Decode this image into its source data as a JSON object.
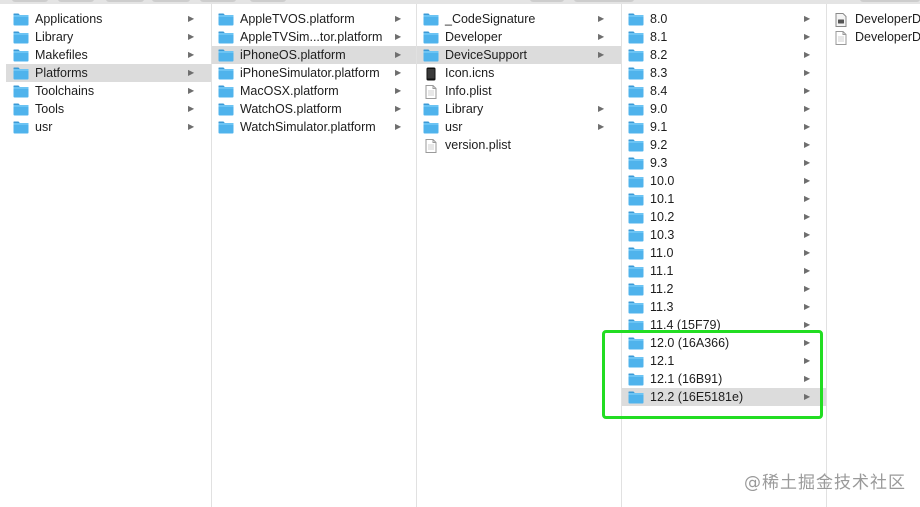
{
  "watermark": "@稀土掘金技术社区",
  "columns": [
    {
      "items": [
        {
          "label": "Applications",
          "icon": "folder-icon",
          "arrow": true,
          "selected": false
        },
        {
          "label": "Library",
          "icon": "folder-icon",
          "arrow": true,
          "selected": false
        },
        {
          "label": "Makefiles",
          "icon": "folder-icon",
          "arrow": true,
          "selected": false
        },
        {
          "label": "Platforms",
          "icon": "folder-icon",
          "arrow": true,
          "selected": true
        },
        {
          "label": "Toolchains",
          "icon": "folder-icon",
          "arrow": true,
          "selected": false
        },
        {
          "label": "Tools",
          "icon": "folder-icon",
          "arrow": true,
          "selected": false
        },
        {
          "label": "usr",
          "icon": "folder-icon",
          "arrow": true,
          "selected": false
        }
      ]
    },
    {
      "items": [
        {
          "label": "AppleTVOS.platform",
          "icon": "folder-icon",
          "arrow": true,
          "selected": false
        },
        {
          "label": "AppleTVSim...tor.platform",
          "icon": "folder-icon",
          "arrow": true,
          "selected": false
        },
        {
          "label": "iPhoneOS.platform",
          "icon": "folder-icon",
          "arrow": true,
          "selected": true
        },
        {
          "label": "iPhoneSimulator.platform",
          "icon": "folder-icon",
          "arrow": true,
          "selected": false
        },
        {
          "label": "MacOSX.platform",
          "icon": "folder-icon",
          "arrow": true,
          "selected": false
        },
        {
          "label": "WatchOS.platform",
          "icon": "folder-icon",
          "arrow": true,
          "selected": false
        },
        {
          "label": "WatchSimulator.platform",
          "icon": "folder-icon",
          "arrow": true,
          "selected": false
        }
      ]
    },
    {
      "items": [
        {
          "label": "_CodeSignature",
          "icon": "folder-icon",
          "arrow": true,
          "selected": false
        },
        {
          "label": "Developer",
          "icon": "folder-icon",
          "arrow": true,
          "selected": false
        },
        {
          "label": "DeviceSupport",
          "icon": "folder-icon",
          "arrow": true,
          "selected": true
        },
        {
          "label": "Icon.icns",
          "icon": "icns-file-icon",
          "arrow": false,
          "selected": false
        },
        {
          "label": "Info.plist",
          "icon": "plist-file-icon",
          "arrow": false,
          "selected": false
        },
        {
          "label": "Library",
          "icon": "folder-icon",
          "arrow": true,
          "selected": false
        },
        {
          "label": "usr",
          "icon": "folder-icon",
          "arrow": true,
          "selected": false
        },
        {
          "label": "version.plist",
          "icon": "plist-file-icon",
          "arrow": false,
          "selected": false
        }
      ]
    },
    {
      "items": [
        {
          "label": "8.0",
          "icon": "folder-icon",
          "arrow": true,
          "selected": false
        },
        {
          "label": "8.1",
          "icon": "folder-icon",
          "arrow": true,
          "selected": false
        },
        {
          "label": "8.2",
          "icon": "folder-icon",
          "arrow": true,
          "selected": false
        },
        {
          "label": "8.3",
          "icon": "folder-icon",
          "arrow": true,
          "selected": false
        },
        {
          "label": "8.4",
          "icon": "folder-icon",
          "arrow": true,
          "selected": false
        },
        {
          "label": "9.0",
          "icon": "folder-icon",
          "arrow": true,
          "selected": false
        },
        {
          "label": "9.1",
          "icon": "folder-icon",
          "arrow": true,
          "selected": false
        },
        {
          "label": "9.2",
          "icon": "folder-icon",
          "arrow": true,
          "selected": false
        },
        {
          "label": "9.3",
          "icon": "folder-icon",
          "arrow": true,
          "selected": false
        },
        {
          "label": "10.0",
          "icon": "folder-icon",
          "arrow": true,
          "selected": false
        },
        {
          "label": "10.1",
          "icon": "folder-icon",
          "arrow": true,
          "selected": false
        },
        {
          "label": "10.2",
          "icon": "folder-icon",
          "arrow": true,
          "selected": false
        },
        {
          "label": "10.3",
          "icon": "folder-icon",
          "arrow": true,
          "selected": false
        },
        {
          "label": "11.0",
          "icon": "folder-icon",
          "arrow": true,
          "selected": false
        },
        {
          "label": "11.1",
          "icon": "folder-icon",
          "arrow": true,
          "selected": false
        },
        {
          "label": "11.2",
          "icon": "folder-icon",
          "arrow": true,
          "selected": false
        },
        {
          "label": "11.3",
          "icon": "folder-icon",
          "arrow": true,
          "selected": false
        },
        {
          "label": "11.4 (15F79)",
          "icon": "folder-icon",
          "arrow": true,
          "selected": false
        },
        {
          "label": "12.0 (16A366)",
          "icon": "folder-icon",
          "arrow": true,
          "selected": false
        },
        {
          "label": "12.1",
          "icon": "folder-icon",
          "arrow": true,
          "selected": false
        },
        {
          "label": "12.1 (16B91)",
          "icon": "folder-icon",
          "arrow": true,
          "selected": false
        },
        {
          "label": "12.2 (16E5181e)",
          "icon": "folder-icon",
          "arrow": true,
          "selected": true
        }
      ]
    },
    {
      "items": [
        {
          "label": "DeveloperD",
          "icon": "disk-image-file-icon",
          "arrow": false,
          "selected": false
        },
        {
          "label": "DeveloperD",
          "icon": "document-file-icon",
          "arrow": false,
          "selected": false
        }
      ]
    }
  ],
  "colors": {
    "folder": "#4fb3ec",
    "folder_tab": "#3b9ad6",
    "selected_row": "#dcdcdc",
    "highlight_box": "#22dd22"
  }
}
